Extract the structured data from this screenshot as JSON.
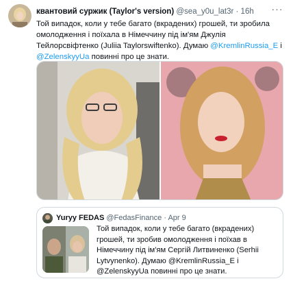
{
  "tweet": {
    "author_name": "квантовий суржик (Taylor's version)",
    "handle": "@sea_y0u_lat3r",
    "separator": "·",
    "time": "16h",
    "more_label": "···",
    "text_before": "Той випадок, коли у тебе багато (вкрадених) грошей, ти зробила омолодження і поїхала в Німеччину під ім'ям Джулія Тейлорсвіфтенко (Juliia Taylorswiftenko). Думаю ",
    "mention_1": "@KremlinRussia_E",
    "text_between": " і ",
    "mention_2": "@ZelenskyyUa",
    "text_after": " повинні про це знати."
  },
  "quote": {
    "author_name": "Yuryy FEDAS",
    "handle": "@FedasFinance",
    "separator": "·",
    "date": "Apr 9",
    "text": "Той випадок, коли у тебе багато (вкрадених) грошей, ти зробив омолодження і поїхав в Німеччину під ім'ям Сергій Литвиненко (Serhii Lytvynenko). Думаю @KremlinRussia_E і @ZelenskyyUa повинні про це знати."
  },
  "colors": {
    "link": "#1d9bf0",
    "secondary_text": "#536471",
    "border": "#cfd9de"
  }
}
